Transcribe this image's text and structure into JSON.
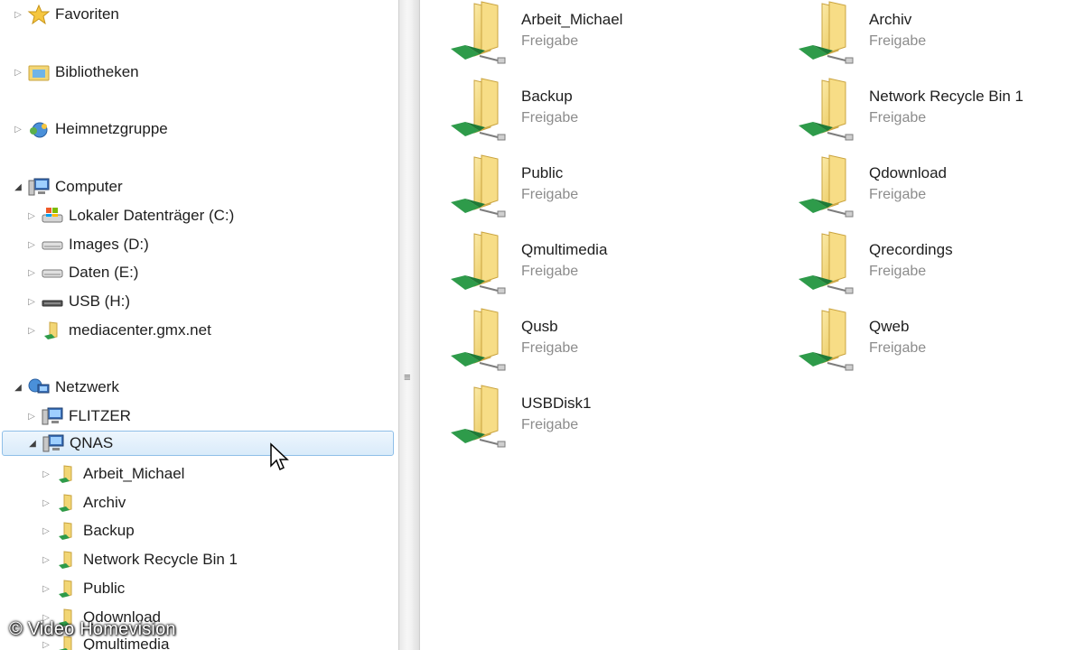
{
  "nav": {
    "favorites": "Favoriten",
    "libraries": "Bibliotheken",
    "homegroup": "Heimnetzgruppe",
    "computer": "Computer",
    "drives": [
      {
        "label": "Lokaler Datenträger (C:)",
        "icon": "system-drive-icon"
      },
      {
        "label": "Images (D:)",
        "icon": "hard-drive-icon"
      },
      {
        "label": "Daten (E:)",
        "icon": "hard-drive-icon"
      },
      {
        "label": "USB (H:)",
        "icon": "usb-drive-icon"
      },
      {
        "label": "mediacenter.gmx.net",
        "icon": "network-folder-icon"
      }
    ],
    "network": "Netzwerk",
    "hosts": [
      {
        "label": "FLITZER",
        "icon": "computer-icon"
      },
      {
        "label": "QNAS",
        "icon": "computer-icon",
        "selected": true
      }
    ],
    "qnas_children": [
      "Arbeit_Michael",
      "Archiv",
      "Backup",
      "Network Recycle Bin 1",
      "Public",
      "Qdownload",
      "Qmultimedia"
    ]
  },
  "shares": [
    {
      "name": "Arbeit_Michael",
      "type": "Freigabe"
    },
    {
      "name": "Archiv",
      "type": "Freigabe"
    },
    {
      "name": "Backup",
      "type": "Freigabe"
    },
    {
      "name": "Network Recycle Bin 1",
      "type": "Freigabe"
    },
    {
      "name": "Public",
      "type": "Freigabe"
    },
    {
      "name": "Qdownload",
      "type": "Freigabe"
    },
    {
      "name": "Qmultimedia",
      "type": "Freigabe"
    },
    {
      "name": "Qrecordings",
      "type": "Freigabe"
    },
    {
      "name": "Qusb",
      "type": "Freigabe"
    },
    {
      "name": "Qweb",
      "type": "Freigabe"
    },
    {
      "name": "USBDisk1",
      "type": "Freigabe"
    }
  ],
  "watermark": "© Video Homevision",
  "colors": {
    "selection_border": "#8fbfe8",
    "selection_fill": "#d9ebfa",
    "folder_yellow": "#f2d675",
    "network_green": "#2e9b4a",
    "secondary_text": "#8c8c8c"
  }
}
